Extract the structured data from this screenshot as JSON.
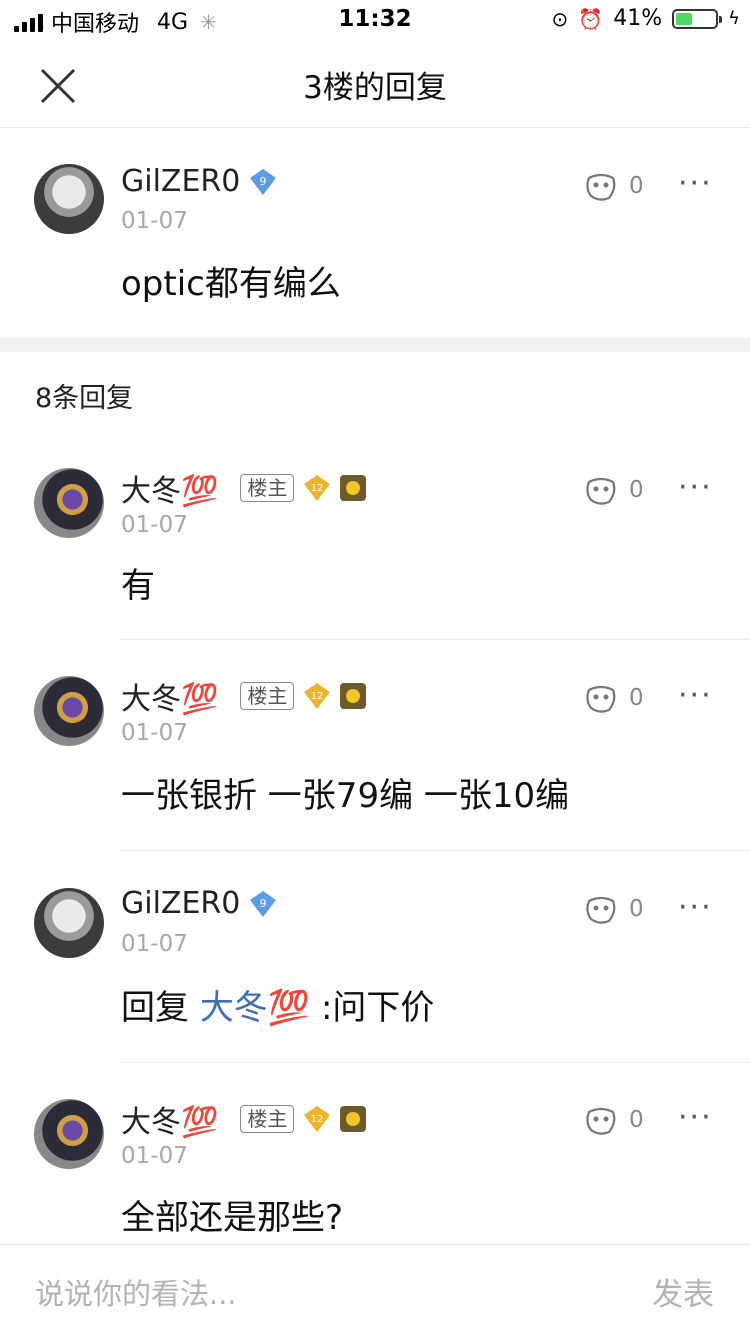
{
  "status_bar": {
    "carrier": "中国移动",
    "network": "4G",
    "time": "11:32",
    "battery": "41%",
    "battery_level": 0.41,
    "battery_color": "#4cd964"
  },
  "nav": {
    "title": "3楼的回复",
    "close_icon": "close-icon"
  },
  "main_post": {
    "user": "GilZER0",
    "badge_level": "9",
    "date": "01-07",
    "content": "optic都有编么",
    "likes": "0"
  },
  "reply_count_label": "8条回复",
  "replies": [
    {
      "user": "大冬💯",
      "tag": "楼主",
      "badge_level": "12",
      "date": "01-07",
      "content": "有",
      "likes": "0"
    },
    {
      "user": "大冬💯",
      "tag": "楼主",
      "badge_level": "12",
      "date": "01-07",
      "content": "一张银折 一张79编 一张10编",
      "likes": "0"
    },
    {
      "user": "GilZER0",
      "badge_level": "9",
      "date": "01-07",
      "content_prefix": "回复 ",
      "content_mention": "大冬💯",
      "content_suffix": " :问下价",
      "likes": "0"
    },
    {
      "user": "大冬💯",
      "tag": "楼主",
      "badge_level": "12",
      "date": "01-07",
      "content": "全部还是那些?",
      "likes": "0"
    }
  ],
  "bottom_bar": {
    "placeholder": "说说你的看法...",
    "send_label": "发表"
  },
  "colors": {
    "link": "#3f6fb0",
    "badge_blue": "#5b9be8",
    "badge_gold": "#f0b428"
  }
}
